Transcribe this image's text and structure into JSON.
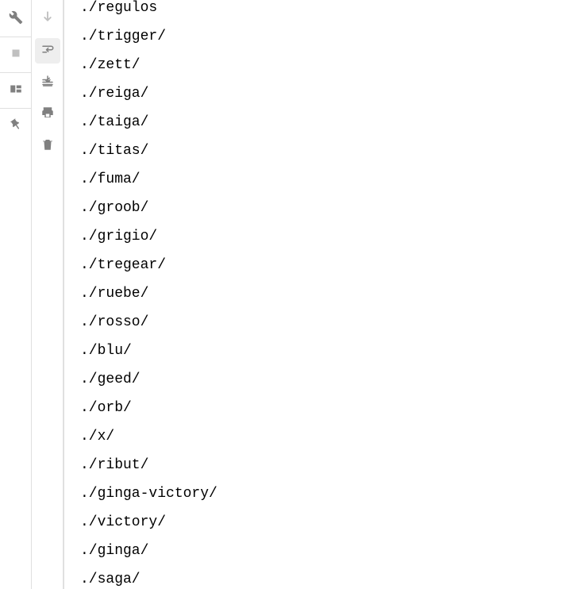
{
  "toolbar_left": {
    "wrench": "wrench-icon",
    "stop": "stop-icon",
    "layout": "layout-icon",
    "pin": "pin-icon"
  },
  "toolbar_right": {
    "down": "arrow-down-icon",
    "wrap": "wrap-icon",
    "scroll_end": "scroll-to-end-icon",
    "print": "print-icon",
    "trash": "trash-icon"
  },
  "output_lines": [
    "./regulos",
    "./trigger/",
    "./zett/",
    "./reiga/",
    "./taiga/",
    "./titas/",
    "./fuma/",
    "./groob/",
    "./grigio/",
    "./tregear/",
    "./ruebe/",
    "./rosso/",
    "./blu/",
    "./geed/",
    "./orb/",
    "./x/",
    "./ribut/",
    "./ginga-victory/",
    "./victory/",
    "./ginga/",
    "./saga/"
  ]
}
